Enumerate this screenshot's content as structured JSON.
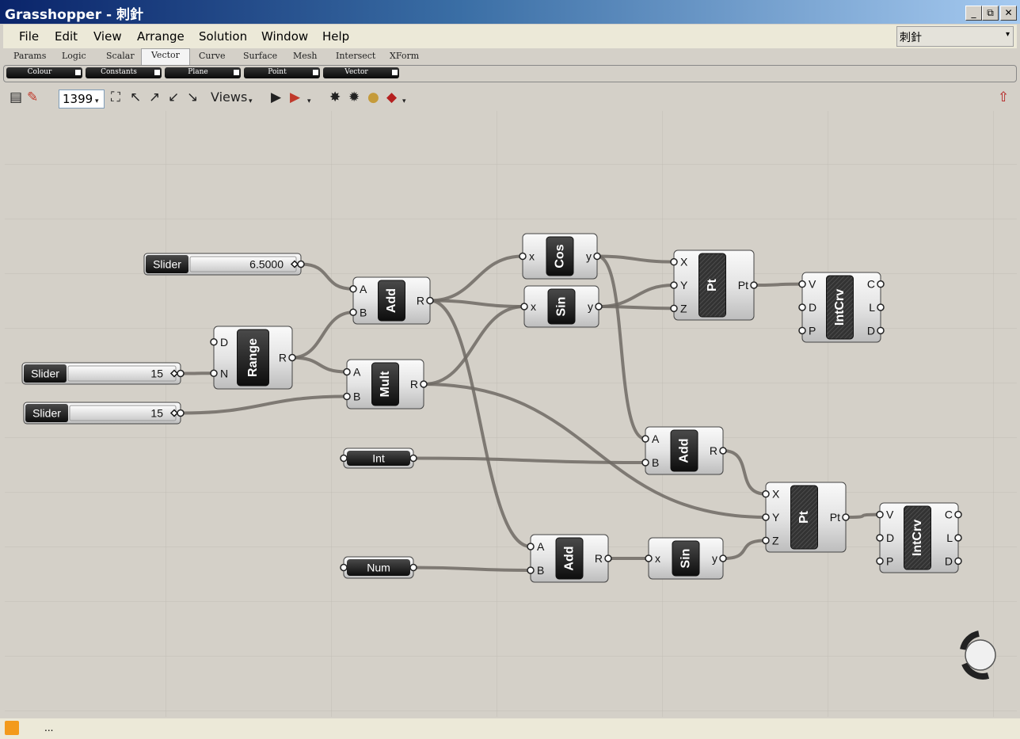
{
  "window": {
    "title": "Grasshopper - 刺針",
    "minimize": "_",
    "restore": "⧉",
    "close": "✕"
  },
  "menu": [
    "File",
    "Edit",
    "View",
    "Arrange",
    "Solution",
    "Window",
    "Help"
  ],
  "document_selector": "刺針",
  "tabs": [
    {
      "label": "Params",
      "active": false
    },
    {
      "label": "Logic",
      "active": false
    },
    {
      "label": "Scalar",
      "active": false
    },
    {
      "label": "Vector",
      "active": true
    },
    {
      "label": "Curve",
      "active": false
    },
    {
      "label": "Surface",
      "active": false
    },
    {
      "label": "Mesh",
      "active": false
    },
    {
      "label": "Intersect",
      "active": false
    },
    {
      "label": "XForm",
      "active": false
    }
  ],
  "panels": [
    "Colour",
    "Constants",
    "Plane",
    "Point",
    "Vector"
  ],
  "toolbar": {
    "zoom_value": "1399",
    "views_label": "Views"
  },
  "components": [
    {
      "id": "slider1",
      "type": "slider",
      "label": "Slider",
      "value": "6.5000"
    },
    {
      "id": "slider2",
      "type": "slider",
      "label": "Slider",
      "value": "15"
    },
    {
      "id": "slider3",
      "type": "slider",
      "label": "Slider",
      "value": "15"
    },
    {
      "id": "range",
      "type": "comp",
      "name": "Range",
      "inputs": [
        "D",
        "N"
      ],
      "outputs": [
        "R"
      ]
    },
    {
      "id": "add1",
      "type": "comp",
      "name": "Add",
      "inputs": [
        "A",
        "B"
      ],
      "outputs": [
        "R"
      ]
    },
    {
      "id": "mult",
      "type": "comp",
      "name": "Mult",
      "inputs": [
        "A",
        "B"
      ],
      "outputs": [
        "R"
      ]
    },
    {
      "id": "cos",
      "type": "comp",
      "name": "Cos",
      "inputs": [
        "x"
      ],
      "outputs": [
        "y"
      ]
    },
    {
      "id": "sin1",
      "type": "comp",
      "name": "Sin",
      "inputs": [
        "x"
      ],
      "outputs": [
        "y"
      ]
    },
    {
      "id": "pt1",
      "type": "comp",
      "name": "Pt",
      "inputs": [
        "X",
        "Y",
        "Z"
      ],
      "outputs": [
        "Pt"
      ]
    },
    {
      "id": "intcrv1",
      "type": "comp",
      "name": "IntCrv",
      "inputs": [
        "V",
        "D",
        "P"
      ],
      "outputs": [
        "C",
        "L",
        "D"
      ]
    },
    {
      "id": "int",
      "type": "param",
      "label": "Int"
    },
    {
      "id": "add2",
      "type": "comp",
      "name": "Add",
      "inputs": [
        "A",
        "B"
      ],
      "outputs": [
        "R"
      ]
    },
    {
      "id": "num",
      "type": "param",
      "label": "Num"
    },
    {
      "id": "add3",
      "type": "comp",
      "name": "Add",
      "inputs": [
        "A",
        "B"
      ],
      "outputs": [
        "R"
      ]
    },
    {
      "id": "sin2",
      "type": "comp",
      "name": "Sin",
      "inputs": [
        "x"
      ],
      "outputs": [
        "y"
      ]
    },
    {
      "id": "pt2",
      "type": "comp",
      "name": "Pt",
      "inputs": [
        "X",
        "Y",
        "Z"
      ],
      "outputs": [
        "Pt"
      ]
    },
    {
      "id": "intcrv2",
      "type": "comp",
      "name": "IntCrv",
      "inputs": [
        "V",
        "D",
        "P"
      ],
      "outputs": [
        "C",
        "L",
        "D"
      ]
    }
  ],
  "wires": [
    [
      "slider1.0",
      "add1.0"
    ],
    [
      "range.0",
      "add1.1"
    ],
    [
      "range.0",
      "mult.0"
    ],
    [
      "slider2.0",
      "range.1"
    ],
    [
      "slider3.0",
      "mult.1"
    ],
    [
      "add1.0",
      "cos.0"
    ],
    [
      "add1.0",
      "sin1.0"
    ],
    [
      "add1.0",
      "add3.0"
    ],
    [
      "mult.0",
      "sin1.0"
    ],
    [
      "mult.0",
      "pt2.1"
    ],
    [
      "cos.0",
      "pt1.0"
    ],
    [
      "cos.0",
      "add2.0"
    ],
    [
      "sin1.0",
      "pt1.1"
    ],
    [
      "sin1.0",
      "pt1.2"
    ],
    [
      "pt1.0",
      "intcrv1.0"
    ],
    [
      "int.0",
      "add2.1"
    ],
    [
      "add2.0",
      "pt2.0"
    ],
    [
      "num.0",
      "add3.1"
    ],
    [
      "add3.0",
      "sin2.0"
    ],
    [
      "sin2.0",
      "pt2.2"
    ],
    [
      "pt2.0",
      "intcrv2.0"
    ]
  ],
  "status": "..."
}
